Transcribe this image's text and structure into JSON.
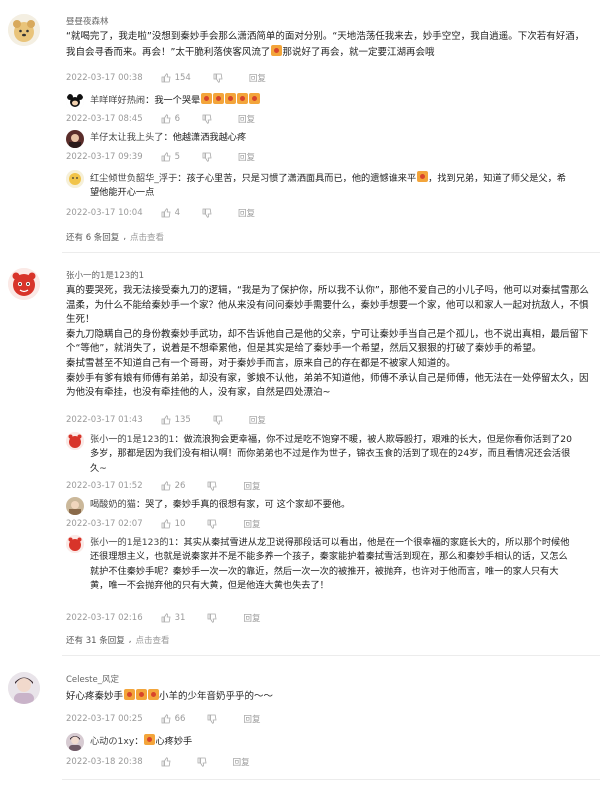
{
  "comments": [
    {
      "user": "昼昼夜森林",
      "text": "“就喝完了，我走啦”没想到秦妙手会那么潇洒简单的面对分别。“天地浩荡任我来去，妙手空空，我自逍遥。下次若有好酒，我自会寻香而来。再会！”太干脆利落侠客风流了",
      "text_tail": "那说好了再会，就一定要江湖再会哦",
      "date": "2022-03-17 00:38",
      "likes": "154",
      "reply_label": "回复",
      "replies": [
        {
          "who": "羊咩咩好热闹",
          "text": "我一个哭晕",
          "date": "2022-03-17 08:45",
          "likes": "6",
          "reply_label": "回复"
        },
        {
          "who": "羊仔太让我上头了",
          "text": "他越潇洒我越心疼",
          "date": "2022-03-17 09:39",
          "likes": "5",
          "reply_label": "回复"
        },
        {
          "who": "红尘倾世负韶华_浮于",
          "text": "孩子心里苦，只是习惯了潇洒面具而已，他的遗憾谁来平",
          "text_tail": "，找到兄弟，知道了师父是父，希望他能开心一点",
          "date": "2022-03-17 10:04",
          "likes": "4",
          "reply_label": "回复"
        }
      ],
      "more_count": "还有 6 条回复",
      "more_view": "点击查看"
    },
    {
      "user": "张小一的1是123的1",
      "paragraphs": [
        "真的要哭死，我无法接受秦九刀的逻辑，“我是为了保护你，所以我不认你”，那他不爱自己的小儿子吗，他可以对秦拭雪那么温柔，为什么不能给秦妙手一个家？他从来没有问问秦妙手需要什么，秦妙手想要一个家，他可以和家人一起对抗敌人，不惧生死！",
        "秦九刀隐瞒自己的身份教秦妙手武功，却不告诉他自己是他的父亲，宁可让秦妙手当自己是个孤儿，也不说出真相，最后留下个“等他”，就消失了，说着是不想牵累他，但是其实是给了秦妙手一个希望，然后又狠狠的打破了秦妙手的希望。",
        "秦拭雪甚至不知道自己有一个哥哥，对于秦妙手而言，原来自己的存在都是不被家人知道的。",
        "秦妙手有爹有娘有师傅有弟弟，却没有家，爹娘不认他，弟弟不知道他，师傅不承认自己是师傅，他无法在一处停留太久，因为他没有牵挂，也没有牵挂他的人，没有家，自然是四处漂泊~"
      ],
      "date": "2022-03-17 01:43",
      "likes": "135",
      "reply_label": "回复",
      "replies": [
        {
          "who": "张小一的1是123的1",
          "text": "做流浪狗会更幸福，你不过是吃不饱穿不暖，被人欺辱殴打，艰难的长大，但是你看你活到了20多岁，那都是因为我们没有相认啊！而你弟弟也不过是作为世子，锦衣玉食的活到了现在的24岁，而且看情况还会活很久~",
          "date": "2022-03-17 01:52",
          "likes": "26",
          "reply_label": "回复"
        },
        {
          "who": "喝酸奶的猫",
          "text": "哭了，秦妙手真的很想有家，可 这个家却不要他。",
          "date": "2022-03-17 02:07",
          "likes": "10",
          "reply_label": "回复"
        },
        {
          "who": "张小一的1是123的1",
          "text": "其实从秦拭雪进从龙卫说得那段话可以看出，他是在一个很幸福的家庭长大的，所以那个时候他还很理想主义，也就是说秦家并不是不能多养一个孩子，秦家能护着秦拭雪活到现在，那么和秦妙手相认的话，又怎么就护不住秦妙手呢？秦妙手一次一次的靠近，然后一次一次的被推开，被抛弃，也许对于他而言，唯一的家人只有大黄，唯一不会抛弃他的只有大黄，但是他连大黄也失去了！",
          "date": "2022-03-17 02:16",
          "likes": "31",
          "reply_label": "回复"
        }
      ],
      "more_count": "还有 31 条回复",
      "more_view": "点击查看"
    },
    {
      "user": "Celeste_风定",
      "text": "好心疼秦妙手",
      "text_tail": "小羊的少年音奶乎乎的～～",
      "date": "2022-03-17 00:25",
      "likes": "66",
      "reply_label": "回复",
      "replies": [
        {
          "who": "心动の1xy",
          "text": "心疼妙手",
          "date": "2022-03-18 20:38",
          "likes": "",
          "reply_label": "回复"
        }
      ]
    }
  ],
  "colors": {
    "text": "#222222",
    "meta": "#9a9a9a",
    "divider": "#ececec"
  }
}
